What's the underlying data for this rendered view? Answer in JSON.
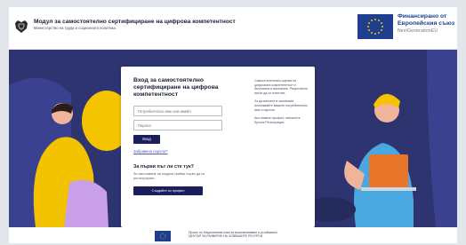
{
  "header": {
    "title": "Модул за самостоятелно сертифициране на цифрова компетентност",
    "subtitle": "Министерство на труда и социалната политика",
    "coat_icon": "coat-of-arms-icon"
  },
  "eu": {
    "line1": "Финансирано от",
    "line2": "Европейския съюз",
    "line3": "NextGenerationEU",
    "flag_icon": "eu-flag-icon",
    "color": "#1e3e8f"
  },
  "login": {
    "title": "Вход за самостоятелно сертифициране на цифрова компетентност",
    "username_placeholder": "Потребителско име или имейл",
    "password_placeholder": "Парола",
    "login_button": "Вход",
    "forgot_link": "Забравена парола?",
    "first_time_title": "За първи път ли сте тук?",
    "first_time_text": "За използване на модула трябва първо да се регистрирате.",
    "register_button": "Създайте си профил",
    "info_1": "Самостоятелната оценка на цифровата компетентност е безплатна и анонимна. Резултатите могат да се изтеглят.",
    "info_2": "За да влезете в системата използвайте вашите потребителско име и парола.",
    "info_3": "Ако нямате профил, натиснете бутона Регистрация."
  },
  "footer": {
    "text_line1": "Проект по Националния план за възстановяване и устойчивост",
    "text_line2": "ЦЕНТЪР ЗА РАЗВИТИЕ НА ЧОВЕШКИТЕ РЕСУРСИ",
    "flag_icon": "eu-flag-icon"
  },
  "colors": {
    "hero_bg": "#2e3470",
    "accent_yellow": "#f5c400",
    "button_navy": "#1a1f5c",
    "laptop_orange": "#e8762a"
  }
}
